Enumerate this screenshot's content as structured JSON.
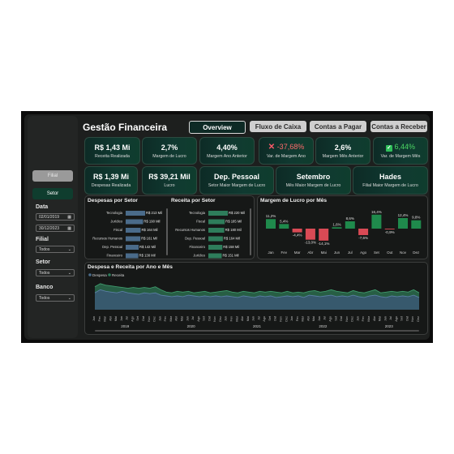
{
  "header": {
    "title": "Gestão Financeira"
  },
  "nav": [
    {
      "label": "Overview",
      "active": true
    },
    {
      "label": "Fluxo de Caixa",
      "active": false
    },
    {
      "label": "Contas a Pagar",
      "active": false
    },
    {
      "label": "Contas a Receber",
      "active": false
    }
  ],
  "kpis_row1": [
    {
      "value": "R$ 1,43 Mi",
      "label": "Receita Realizada"
    },
    {
      "value": "2,7%",
      "label": "Margem de Lucro"
    },
    {
      "value": "4,40%",
      "label": "Margem Ano Anterior"
    },
    {
      "value": "-37,68%",
      "label": "Var. de Margem Ano",
      "status": "negative",
      "icon": "x-mark-icon"
    },
    {
      "value": "2,6%",
      "label": "Margem Mês Anterior"
    },
    {
      "value": "6,44%",
      "label": "Var. de Margem Mês",
      "status": "positive",
      "icon": "check-box-icon"
    }
  ],
  "kpis_row2": [
    {
      "value": "R$ 1,39 Mi",
      "label": "Despesas Realizada"
    },
    {
      "value": "R$ 39,21 Mil",
      "label": "Lucro"
    },
    {
      "value": "Dep. Pessoal",
      "label": "Setor Maior Margem de Lucro"
    },
    {
      "value": "Setembro",
      "label": "Mês Maior Margem de Lucro"
    },
    {
      "value": "Hades",
      "label": "Filial Maior Margem de Lucro"
    }
  ],
  "sidebar": {
    "toggle": [
      {
        "label": "Filial",
        "active": false
      },
      {
        "label": "Setor",
        "active": true
      }
    ],
    "date_label": "Data",
    "date_start": "02/01/2019",
    "date_end": "30/12/2023",
    "filial_label": "Filial",
    "filial_value": "Todos",
    "setor_label": "Setor",
    "setor_value": "Todos",
    "banco_label": "Banco",
    "banco_value": "Todos"
  },
  "despesas_panel": {
    "title": "Despesas por Setor",
    "rows": [
      {
        "label": "Tecnologia",
        "value": 213,
        "text": "R$ 213 Mil"
      },
      {
        "label": "Jurídico",
        "value": 190,
        "text": "R$ 190 Mil"
      },
      {
        "label": "Fiscal",
        "value": 164,
        "text": "R$ 164 Mil"
      },
      {
        "label": "Recursos Humanos",
        "value": 161,
        "text": "R$ 161 Mil"
      },
      {
        "label": "Dep. Pessoal",
        "value": 142,
        "text": "R$ 142 Mil"
      },
      {
        "label": "Financeiro",
        "value": 138,
        "text": "R$ 138 Mil"
      }
    ]
  },
  "receita_panel": {
    "title": "Receita por Setor",
    "rows": [
      {
        "label": "Tecnologia",
        "value": 220,
        "text": "R$ 220 Mil"
      },
      {
        "label": "Fiscal",
        "value": 185,
        "text": "R$ 185 Mil"
      },
      {
        "label": "Recursos Humanos",
        "value": 180,
        "text": "R$ 180 Mil"
      },
      {
        "label": "Dep. Pessoal",
        "value": 164,
        "text": "R$ 164 Mil"
      },
      {
        "label": "Financeiro",
        "value": 158,
        "text": "R$ 158 Mil"
      },
      {
        "label": "Jurídico",
        "value": 151,
        "text": "R$ 151 Mil"
      }
    ]
  },
  "margem_panel": {
    "title": "Margem de Lucro por Mês",
    "months": [
      "Jan",
      "Fev",
      "Mar",
      "Abr",
      "Mai",
      "Jun",
      "Jul",
      "Ago",
      "Set",
      "Out",
      "Nov",
      "Dez"
    ],
    "values": [
      11.2,
      5.4,
      -4.4,
      -13.0,
      -14.1,
      1.6,
      8.6,
      -7.6,
      16.4,
      -0.9,
      12.4,
      9.8
    ],
    "labels": [
      "11,2%",
      "5,4%",
      "-4,4%",
      "-13,0%",
      "-14,1%",
      "1,6%",
      "8,6%",
      "-7,6%",
      "16,4%",
      "-0,9%",
      "12,4%",
      "9,8%"
    ],
    "positive_color": "#1f8a4c",
    "negative_color": "#d94a55"
  },
  "trend_panel": {
    "title": "Despesa e Receita por Ano e Mês",
    "legend": [
      {
        "name": "Despesa",
        "color": "#4a6b8a"
      },
      {
        "name": "Receita",
        "color": "#2e7d5b"
      }
    ],
    "month_ticks": [
      "Jan",
      "Fev",
      "Mar",
      "Abr",
      "Mai",
      "Jun",
      "Jul",
      "Ago",
      "Set",
      "Out",
      "Nov",
      "Dez"
    ],
    "years": [
      "2019",
      "2020",
      "2021",
      "2022",
      "2023"
    ],
    "receita": [
      30,
      34,
      32,
      31,
      30,
      29,
      28,
      29,
      28,
      29,
      28,
      30,
      26,
      23,
      22,
      24,
      23,
      24,
      22,
      23,
      24,
      22,
      23,
      24,
      25,
      23,
      22,
      24,
      23,
      22,
      24,
      23,
      24,
      23,
      22,
      24,
      22,
      23,
      22,
      24,
      25,
      23,
      24,
      26,
      24,
      23,
      22,
      25,
      23,
      22,
      24,
      26,
      22,
      23,
      24,
      23,
      24,
      23,
      26,
      22
    ],
    "despesa": [
      22,
      26,
      24,
      23,
      22,
      24,
      22,
      21,
      20,
      22,
      21,
      22,
      19,
      18,
      17,
      18,
      17,
      19,
      18,
      17,
      18,
      17,
      18,
      17,
      18,
      17,
      16,
      18,
      17,
      16,
      18,
      17,
      18,
      16,
      17,
      18,
      17,
      18,
      16,
      19,
      18,
      17,
      18,
      19,
      17,
      18,
      17,
      19,
      17,
      16,
      18,
      19,
      17,
      16,
      18,
      17,
      18,
      17,
      19,
      16
    ]
  },
  "colors": {
    "accent": "#0f3d2e",
    "kpi_bg": "#103a31",
    "despesa_bar": "#4a6b8a",
    "receita_bar": "#2e7d5b",
    "negative_text": "#ff6b6b",
    "positive_text": "#4cd964"
  }
}
